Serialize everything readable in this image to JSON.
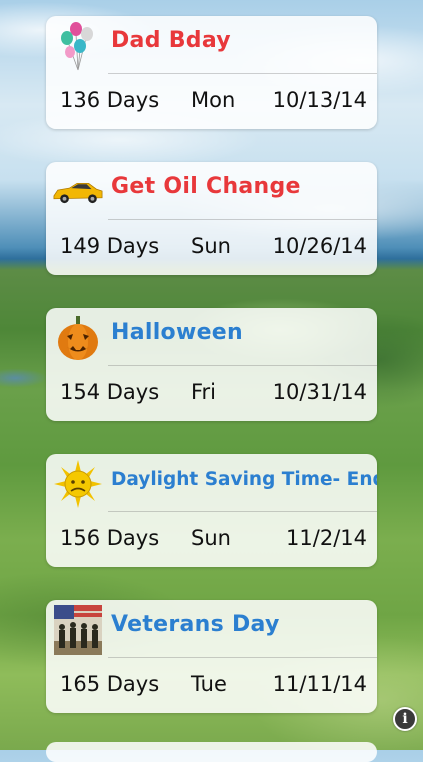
{
  "colors": {
    "red_title": "#e8383b",
    "blue_title": "#2b7fd0",
    "text": "#111111"
  },
  "events": [
    {
      "title": "Dad Bday",
      "days": "136 Days",
      "dow": "Mon",
      "date": "10/13/14",
      "icon": "balloons-icon"
    },
    {
      "title": "Get Oil Change",
      "days": "149 Days",
      "dow": "Sun",
      "date": "10/26/14",
      "icon": "sports-car-icon"
    },
    {
      "title": "Halloween",
      "days": "154 Days",
      "dow": "Fri",
      "date": "10/31/14",
      "icon": "pumpkin-icon"
    },
    {
      "title": "Daylight Saving Time- End",
      "days": "156 Days",
      "dow": "Sun",
      "date": "11/2/14",
      "icon": "sun-icon"
    },
    {
      "title": "Veterans Day",
      "days": "165 Days",
      "dow": "Tue",
      "date": "11/11/14",
      "icon": "soldiers-flag-icon"
    }
  ],
  "info_button": {
    "glyph": "i",
    "icon": "info-icon"
  }
}
